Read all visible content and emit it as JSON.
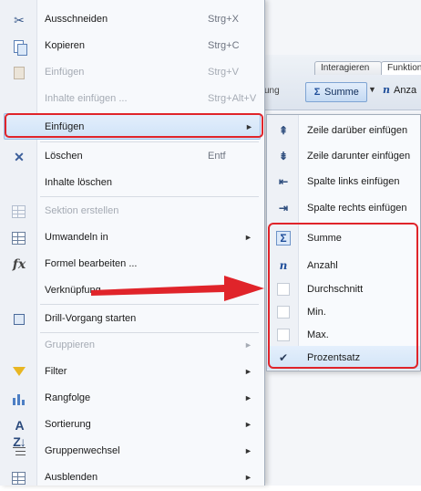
{
  "background": {
    "tabs": [
      "Interagieren",
      "Funktion"
    ],
    "summe_button": "Summe",
    "anzahl_button": "Anza",
    "partial_label": "ung"
  },
  "context_menu": {
    "items": [
      {
        "label": "Ausschneiden",
        "shortcut": "Strg+X",
        "icon": "scissors-icon",
        "disabled": false
      },
      {
        "label": "Kopieren",
        "shortcut": "Strg+C",
        "icon": "copy-icon",
        "disabled": false
      },
      {
        "label": "Einfügen",
        "shortcut": "Strg+V",
        "icon": "paste-icon",
        "disabled": true
      },
      {
        "label": "Inhalte einfügen ...",
        "shortcut": "Strg+Alt+V",
        "icon": "",
        "disabled": true
      },
      {
        "label": "Einfügen",
        "shortcut": "",
        "icon": "",
        "disabled": false,
        "submenu": true,
        "highlighted": true
      },
      {
        "label": "Löschen",
        "shortcut": "Entf",
        "icon": "delete-icon",
        "disabled": false
      },
      {
        "label": "Inhalte löschen",
        "shortcut": "",
        "icon": "",
        "disabled": false
      },
      {
        "label": "Sektion erstellen",
        "shortcut": "",
        "icon": "section-icon",
        "disabled": true
      },
      {
        "label": "Umwandeln in",
        "shortcut": "",
        "icon": "convert-icon",
        "disabled": false,
        "submenu": true
      },
      {
        "label": "Formel bearbeiten ...",
        "shortcut": "",
        "icon": "formula-icon",
        "disabled": false
      },
      {
        "label": "Verknüpfung",
        "shortcut": "",
        "icon": "",
        "disabled": false,
        "submenu": true
      },
      {
        "label": "Drill-Vorgang starten",
        "shortcut": "",
        "icon": "drill-icon",
        "disabled": false
      },
      {
        "label": "Gruppieren",
        "shortcut": "",
        "icon": "",
        "disabled": true,
        "submenu": true
      },
      {
        "label": "Filter",
        "shortcut": "",
        "icon": "filter-icon",
        "disabled": false,
        "submenu": true
      },
      {
        "label": "Rangfolge",
        "shortcut": "",
        "icon": "ranking-icon",
        "disabled": false,
        "submenu": true
      },
      {
        "label": "Sortierung",
        "shortcut": "",
        "icon": "sort-icon",
        "disabled": false,
        "submenu": true
      },
      {
        "label": "Gruppenwechsel",
        "shortcut": "",
        "icon": "break-icon",
        "disabled": false,
        "submenu": true
      },
      {
        "label": "Ausblenden",
        "shortcut": "",
        "icon": "hide-icon",
        "disabled": false,
        "submenu": true
      }
    ],
    "submenu_glyph": "►"
  },
  "submenu": {
    "items": [
      {
        "label": "Zeile darüber einfügen",
        "icon": "insert-row-above-icon"
      },
      {
        "label": "Zeile darunter einfügen",
        "icon": "insert-row-below-icon"
      },
      {
        "label": "Spalte links einfügen",
        "icon": "insert-column-left-icon"
      },
      {
        "label": "Spalte rechts einfügen",
        "icon": "insert-column-right-icon"
      },
      {
        "label": "Summe",
        "icon": "sum-icon"
      },
      {
        "label": "Anzahl",
        "icon": "count-icon"
      },
      {
        "label": "Durchschnitt",
        "icon": "blank-icon"
      },
      {
        "label": "Min.",
        "icon": "blank-icon"
      },
      {
        "label": "Max.",
        "icon": "blank-icon"
      },
      {
        "label": "Prozentsatz",
        "icon": "check-icon",
        "checked": true
      }
    ]
  },
  "colors": {
    "highlight_frame": "#e0242a",
    "arrow": "#e0242a",
    "accent": "#1f4e9a"
  }
}
